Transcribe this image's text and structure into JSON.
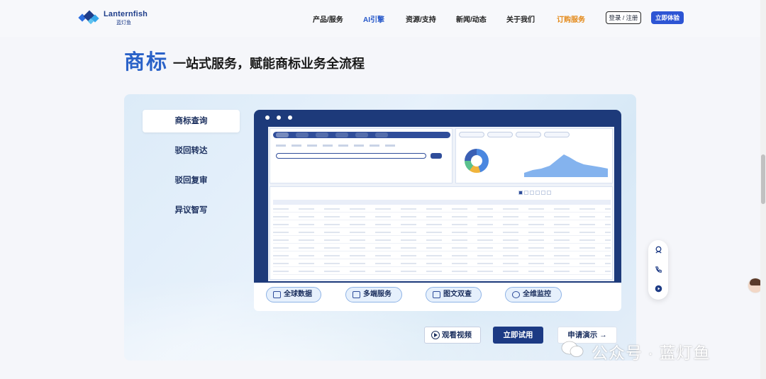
{
  "brand": {
    "name": "Lanternfish",
    "sub": "蓝灯鱼"
  },
  "nav": {
    "items": [
      {
        "label": "产品/服务"
      },
      {
        "label": "AI引擎"
      },
      {
        "label": "资源/支持"
      },
      {
        "label": "新闻/动态"
      },
      {
        "label": "关于我们"
      },
      {
        "label": "订购服务"
      }
    ],
    "login": "登录 / 注册",
    "try_now": "立即体验"
  },
  "hero": {
    "title": "商标",
    "subtitle": "一站式服务，赋能商标业务全流程"
  },
  "tabs": [
    {
      "label": "商标查询",
      "active": true
    },
    {
      "label": "驳回转达",
      "active": false
    },
    {
      "label": "驳回复审",
      "active": false
    },
    {
      "label": "异议智写",
      "active": false
    }
  ],
  "features": [
    {
      "label": "全球数据",
      "icon": "globe-data-icon"
    },
    {
      "label": "多端服务",
      "icon": "multi-device-icon"
    },
    {
      "label": "图文双查",
      "icon": "image-text-icon"
    },
    {
      "label": "全维监控",
      "icon": "monitor-icon"
    }
  ],
  "cta": {
    "video": "观看视频",
    "trial": "立即试用",
    "demo": "申请演示 →"
  },
  "watermark": "公众号 · 蓝灯鱼",
  "colors": {
    "accent": "#2d55d4",
    "primary_dark": "#1c3a84",
    "orange": "#e48a1a",
    "title_blue": "#2a62c8"
  }
}
